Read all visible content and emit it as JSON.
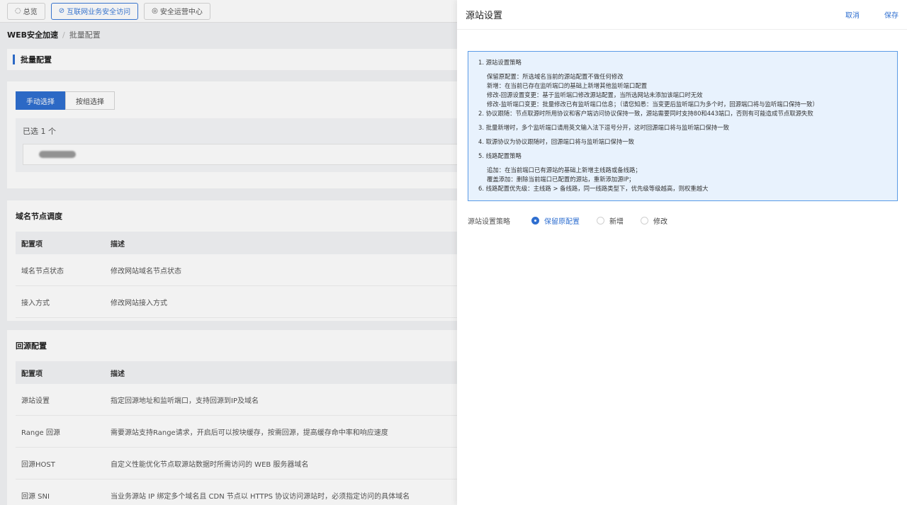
{
  "top_tabs": [
    {
      "icon": "◌",
      "label": "总览"
    },
    {
      "icon": "⊘",
      "label": "互联网业务安全访问"
    },
    {
      "icon": "◎",
      "label": "安全运营中心"
    }
  ],
  "breadcrumb": {
    "root": "WEB安全加速",
    "sep": "/",
    "current": "批量配置"
  },
  "batch_card": {
    "title": "批量配置",
    "segments": [
      "手动选择",
      "按组选择"
    ],
    "selected_text": "已选 1 个"
  },
  "domain_section": {
    "title": "域名节点调度",
    "headers": [
      "配置项",
      "描述"
    ],
    "rows": [
      {
        "item": "域名节点状态",
        "desc": "修改网站域名节点状态"
      },
      {
        "item": "接入方式",
        "desc": "修改网站接入方式"
      }
    ]
  },
  "origin_section": {
    "title": "回源配置",
    "headers": [
      "配置项",
      "描述"
    ],
    "rows": [
      {
        "item": "源站设置",
        "desc": "指定回源地址和监听端口，支持回源到IP及域名"
      },
      {
        "item": "Range 回源",
        "desc": "需要源站支持Range请求，开启后可以按块缓存，按需回源，提高缓存命中率和响应速度"
      },
      {
        "item": "回源HOST",
        "desc": "自定义性能优化节点取源站数据时所需访问的 WEB 服务器域名"
      },
      {
        "item": "回源 SNI",
        "desc": "当业务源站 IP 绑定多个域名且 CDN 节点以 HTTPS 协议访问源站时，必须指定访问的具体域名"
      }
    ]
  },
  "drawer": {
    "title": "源站设置",
    "cancel": "取消",
    "save": "保存",
    "notice": [
      {
        "type": "item",
        "text": "1. 源站设置策略"
      },
      {
        "type": "gap"
      },
      {
        "type": "sub",
        "text": "保留原配置：所选域名当前的源站配置不做任何修改"
      },
      {
        "type": "sub",
        "text": "新增：在当前已存在监听端口的基础上新增其他监听端口配置"
      },
      {
        "type": "sub",
        "text": "修改-回源设置变更：基于监听端口修改源站配置，当所选网站未添加该端口时无效"
      },
      {
        "type": "sub",
        "text": "修改-监听端口变更：批量修改已有监听端口信息；（请您知悉：当变更后监听端口为多个时，回源端口将与监听端口保持一致）"
      },
      {
        "type": "item",
        "text": "2. 协议跟随：节点取源时所用协议和客户端访问协议保持一致，源站需要同时支持80和443端口，否则有可能造成节点取源失败"
      },
      {
        "type": "gap"
      },
      {
        "type": "item",
        "text": "3. 批量新增时，多个监听端口请用英文输入法下逗号分开，这时回源端口将与监听端口保持一致"
      },
      {
        "type": "gap"
      },
      {
        "type": "item",
        "text": "4. 取源协议为协议跟随时，回源端口将与监听端口保持一致"
      },
      {
        "type": "gap"
      },
      {
        "type": "item",
        "text": "5. 线路配置策略"
      },
      {
        "type": "gap"
      },
      {
        "type": "sub",
        "text": "追加：在当前端口已有源站的基础上新增主线路或备线路；"
      },
      {
        "type": "sub",
        "text": "覆盖添加：删除当前端口已配置的源站，重新添加源IP；"
      },
      {
        "type": "item",
        "text": "6. 线路配置优先级：主线路 > 备线路，同一线路类型下，优先级等级越高，则权重越大"
      }
    ],
    "strategy_label": "源站设置策略",
    "strategy_options": [
      "保留原配置",
      "新增",
      "修改"
    ],
    "strategy_selected": "保留原配置"
  }
}
